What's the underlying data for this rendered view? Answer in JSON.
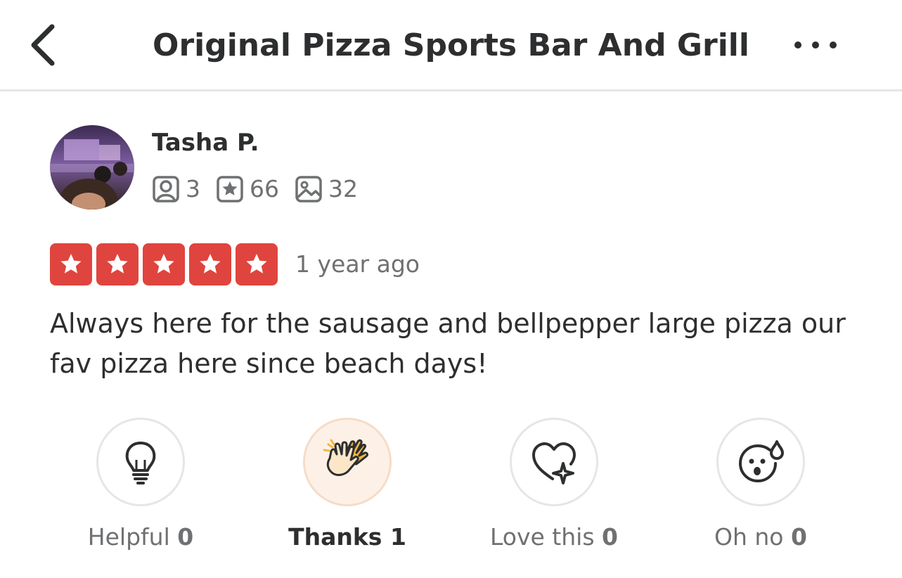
{
  "header": {
    "title": "Original Pizza Sports Bar And Grill",
    "back_icon": "chevron-left-icon",
    "more_icon": "more-horizontal-icon"
  },
  "review": {
    "author": "Tasha P.",
    "stats": [
      {
        "icon": "friends-icon",
        "value": "3"
      },
      {
        "icon": "reviews-star-icon",
        "value": "66"
      },
      {
        "icon": "photos-icon",
        "value": "32"
      }
    ],
    "rating": 5,
    "time_ago": "1 year ago",
    "text": "Always here for the sausage and bellpepper large pizza our fav pizza here since beach days!"
  },
  "reactions": [
    {
      "label": "Helpful",
      "count": "0",
      "icon": "lightbulb-icon",
      "active": false
    },
    {
      "label": "Thanks",
      "count": "1",
      "icon": "high-five-icon",
      "active": true
    },
    {
      "label": "Love this",
      "count": "0",
      "icon": "heart-sparkle-icon",
      "active": false
    },
    {
      "label": "Oh no",
      "count": "0",
      "icon": "shocked-face-icon",
      "active": false
    }
  ],
  "colors": {
    "star_red": "#e0443e",
    "text_dark": "#2d2e2f",
    "text_muted": "#6e7072",
    "active_bg": "#fdf1e7"
  }
}
